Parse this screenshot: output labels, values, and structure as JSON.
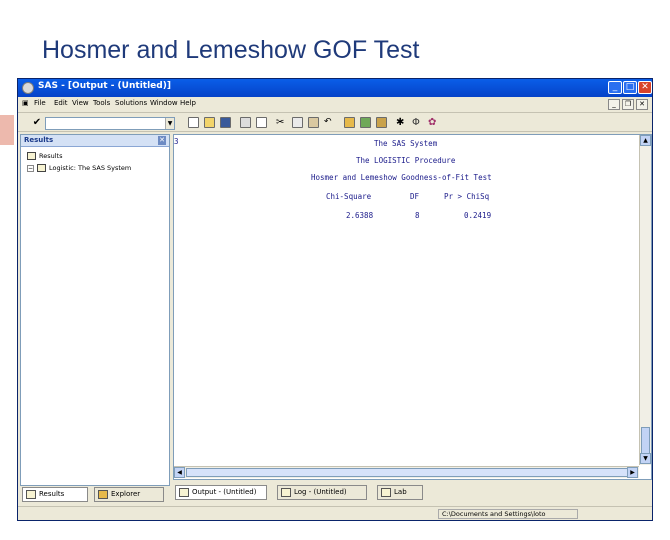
{
  "slide": {
    "title": "Hosmer and Lemeshow GOF Test"
  },
  "window": {
    "title": "SAS - [Output - (Untitled)]"
  },
  "menu": [
    "File",
    "Edit",
    "View",
    "Tools",
    "Solutions",
    "Window",
    "Help"
  ],
  "toolbar": {
    "command_value": ""
  },
  "results": {
    "header": "Results",
    "tree": [
      {
        "label": "Results",
        "level": 0
      },
      {
        "label": "Logistic: The SAS System",
        "level": 1
      }
    ],
    "tabs": [
      "Results",
      "Explorer"
    ]
  },
  "output": {
    "page_marker": "3",
    "system_title": "The SAS System",
    "procedure": "The LOGISTIC Procedure",
    "test_title": "Hosmer and Lemeshow Goodness-of-Fit Test",
    "columns": [
      "Chi-Square",
      "DF",
      "Pr > ChiSq"
    ],
    "values": [
      "2.6388",
      "8",
      "0.2419"
    ]
  },
  "window_tabs": [
    "Output - (Untitled)",
    "Log - (Untitled)",
    "Lab"
  ],
  "status": {
    "path": "C:\\Documents and Settings\\loto"
  },
  "colors": {
    "titlebar": "#0542c8",
    "output_text": "#1a1a8a",
    "slide_title": "#1f3a7a"
  }
}
